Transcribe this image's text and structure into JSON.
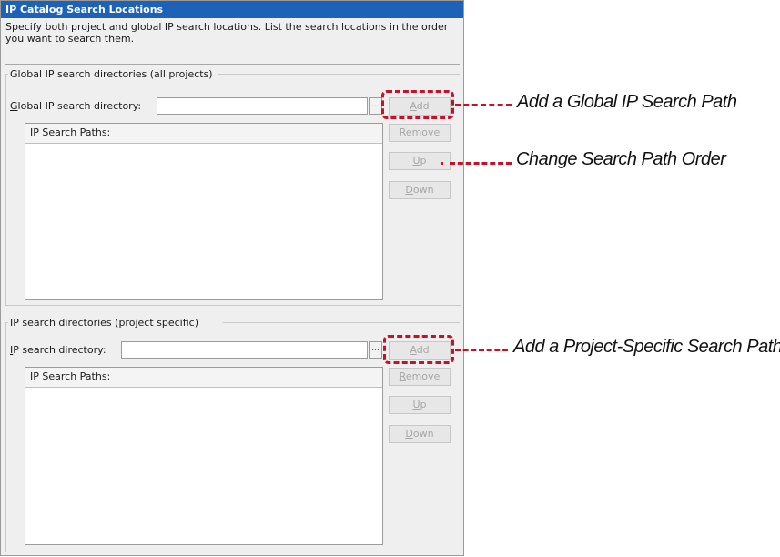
{
  "dialog": {
    "title": "IP Catalog Search Locations",
    "description": "Specify both project and global IP search locations. List the search locations in the order you want to search them."
  },
  "global_group": {
    "title": "Global IP search directories (all projects)",
    "dir_label_accel": "G",
    "dir_label_rest": "lobal IP search directory:",
    "dir_value": "",
    "browse_label": "...",
    "list_header": "IP Search Paths:",
    "paths": [],
    "buttons": {
      "add_accel": "A",
      "add_rest": "dd",
      "remove_accel": "R",
      "remove_rest": "emove",
      "up_accel": "U",
      "up_rest": "p",
      "down_accel": "D",
      "down_rest": "own"
    }
  },
  "project_group": {
    "title": "IP search directories (project specific)",
    "dir_label_accel": "I",
    "dir_label_rest": "P search directory:",
    "dir_value": "",
    "browse_label": "...",
    "list_header": "IP Search Paths:",
    "paths": [],
    "buttons": {
      "add_accel": "A",
      "add_rest": "dd",
      "remove_accel": "R",
      "remove_rest": "emove",
      "up_accel": "U",
      "up_rest": "p",
      "down_accel": "D",
      "down_rest": "own"
    }
  },
  "annotations": {
    "global_add": "Add a Global IP Search Path",
    "order": "Change Search Path Order",
    "project_add": "Add a Project-Specific Search Path",
    "color": "#c4122a"
  }
}
